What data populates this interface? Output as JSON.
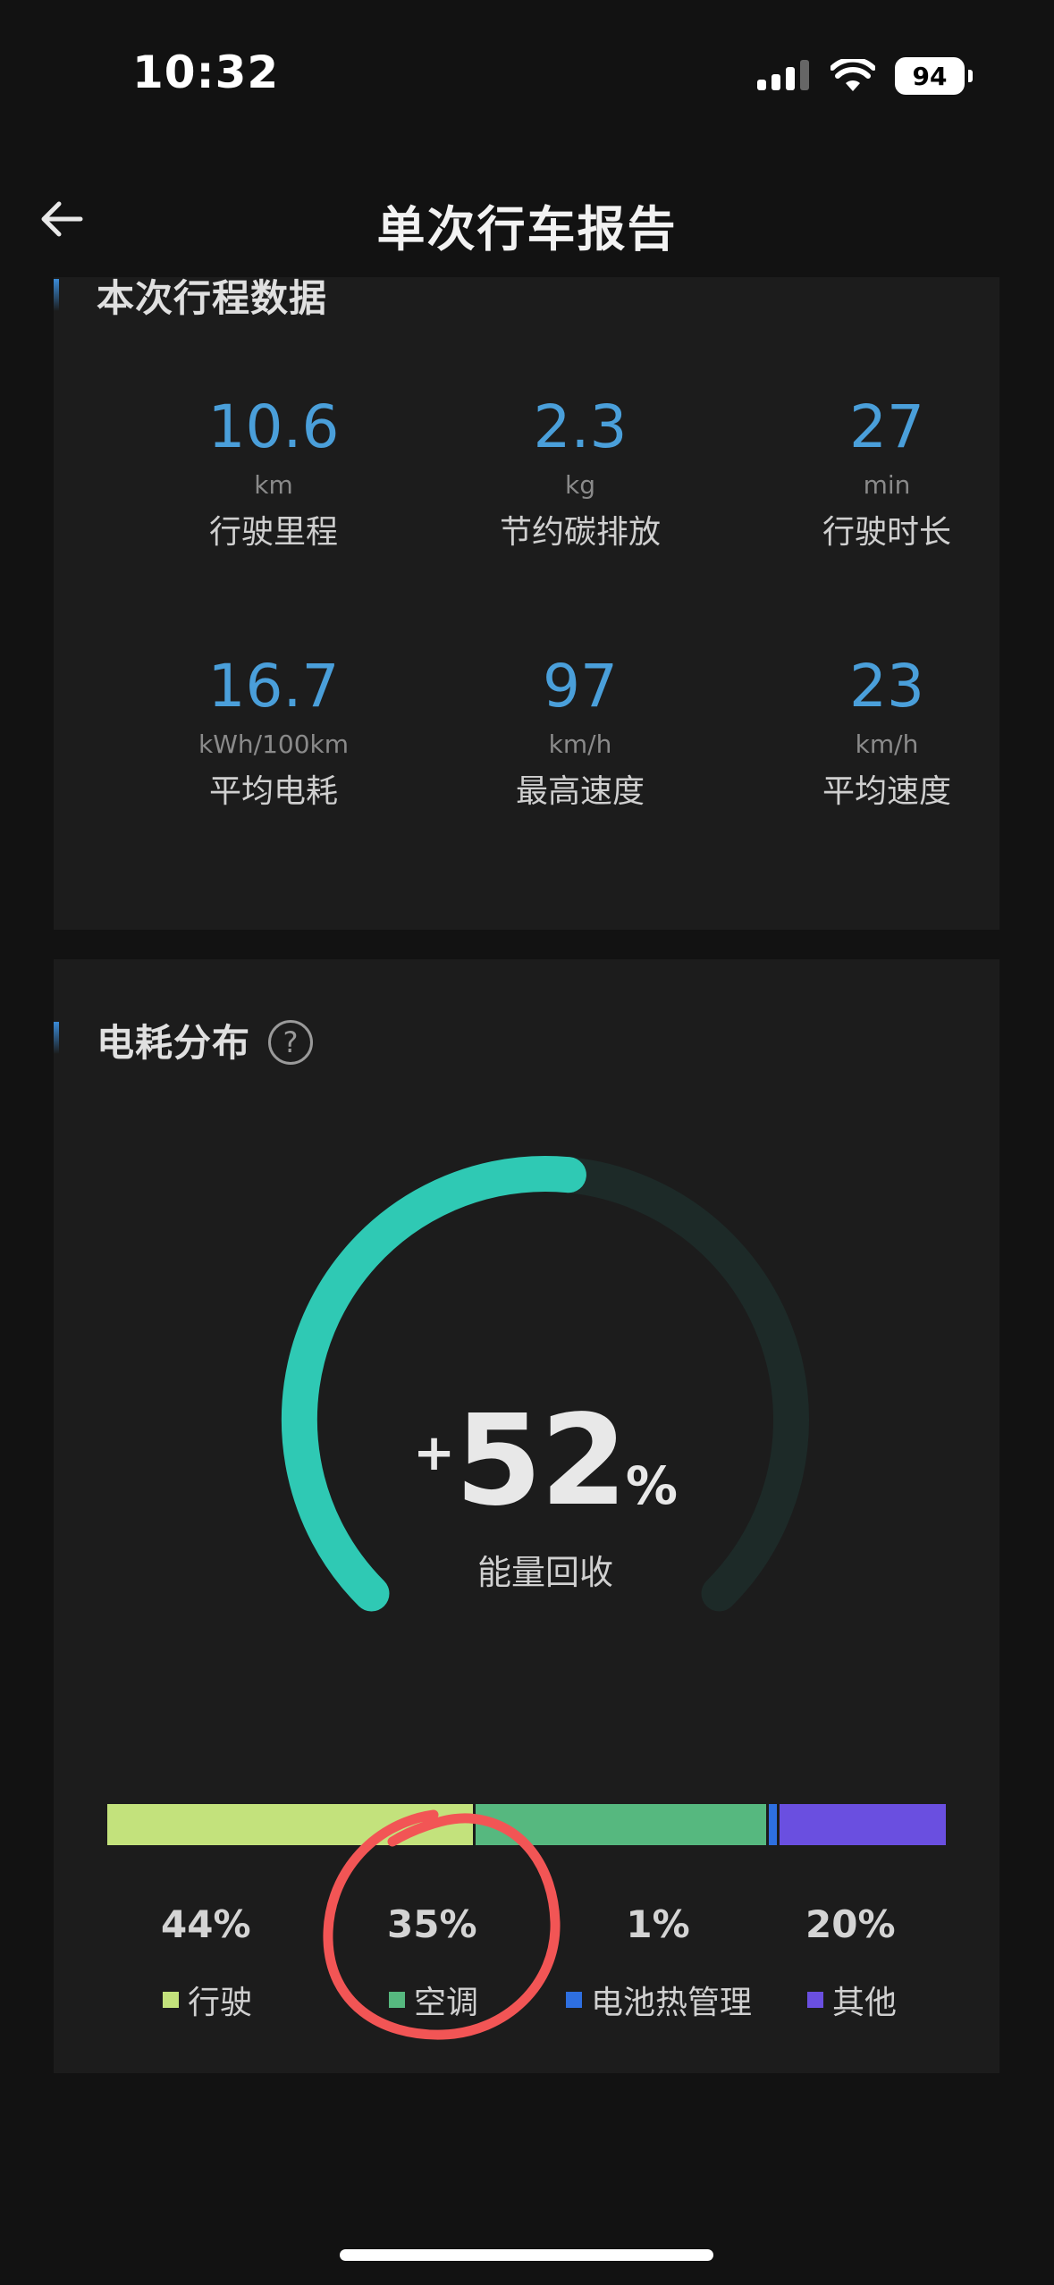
{
  "status_bar": {
    "time": "10:32",
    "battery": "94"
  },
  "header": {
    "title": "单次行车报告"
  },
  "trip_section": {
    "title": "本次行程数据",
    "metrics": [
      {
        "value": "10.6",
        "unit": "km",
        "label": "行驶里程"
      },
      {
        "value": "2.3",
        "unit": "kg",
        "label": "节约碳排放"
      },
      {
        "value": "27",
        "unit": "min",
        "label": "行驶时长"
      },
      {
        "value": "16.7",
        "unit": "kWh/100km",
        "label": "平均电耗"
      },
      {
        "value": "97",
        "unit": "km/h",
        "label": "最高速度"
      },
      {
        "value": "23",
        "unit": "km/h",
        "label": "平均速度"
      }
    ]
  },
  "energy_section": {
    "title": "电耗分布",
    "help_glyph": "?",
    "gauge": {
      "sign": "+",
      "value": "52",
      "unit": "%",
      "label": "能量回收",
      "fraction": 0.52
    },
    "distribution": [
      {
        "name": "行驶",
        "percent": "44%",
        "share": 44,
        "color": "#c3e27c"
      },
      {
        "name": "空调",
        "percent": "35%",
        "share": 35,
        "color": "#56b87f"
      },
      {
        "name": "电池热管理",
        "percent": "1%",
        "share": 1,
        "color": "#2e6fe0"
      },
      {
        "name": "其他",
        "percent": "20%",
        "share": 20,
        "color": "#6a4fe0"
      }
    ]
  },
  "colors": {
    "accent": "#4a9fda",
    "gauge_fill": "#2fc9b4",
    "gauge_track": "#1d2a28",
    "annotation": "#f25555"
  }
}
